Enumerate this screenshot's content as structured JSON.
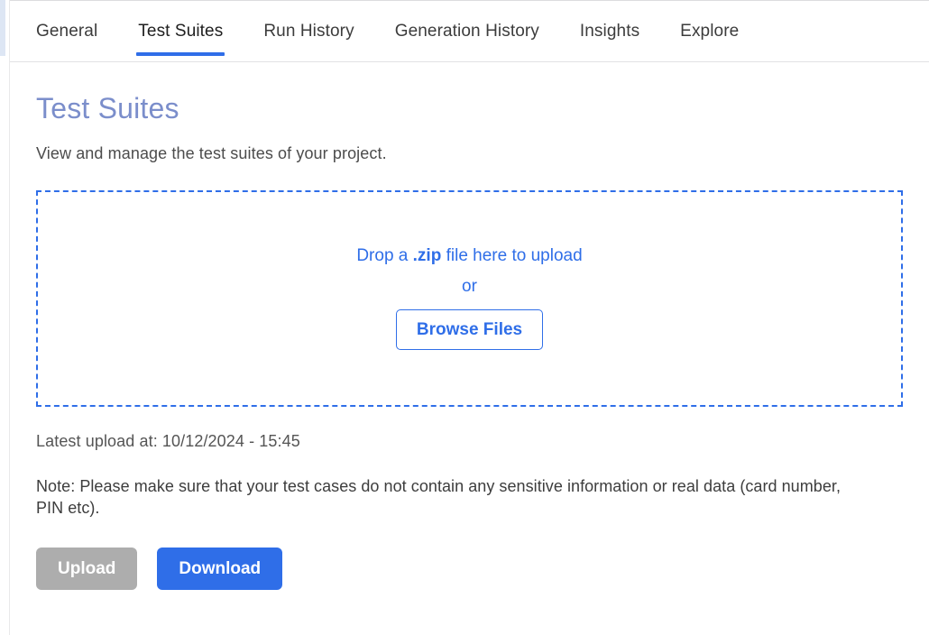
{
  "theme": {
    "accent": "#2f6ee8",
    "title_color": "#7b8ecb",
    "disabled_button": "#adadad",
    "sidebar_marker": "#dde6f4"
  },
  "tabs": [
    {
      "label": "General",
      "active": false
    },
    {
      "label": "Test Suites",
      "active": true
    },
    {
      "label": "Run History",
      "active": false
    },
    {
      "label": "Generation History",
      "active": false
    },
    {
      "label": "Insights",
      "active": false
    },
    {
      "label": "Explore",
      "active": false
    }
  ],
  "page": {
    "title": "Test Suites",
    "subtitle": "View and manage the test suites of your project."
  },
  "dropzone": {
    "prompt_before": "Drop a ",
    "prompt_filetype": ".zip",
    "prompt_after": " file here to upload",
    "or_label": "or",
    "browse_label": "Browse Files"
  },
  "meta": {
    "latest_upload_label": "Latest upload at:",
    "latest_upload_value": "10/12/2024 - 15:45",
    "latest_upload_full": "Latest upload at: 10/12/2024 - 15:45",
    "note": "Note: Please make sure that your test cases do not contain any sensitive information or real data (card number, PIN etc)."
  },
  "actions": {
    "upload_label": "Upload",
    "download_label": "Download"
  }
}
